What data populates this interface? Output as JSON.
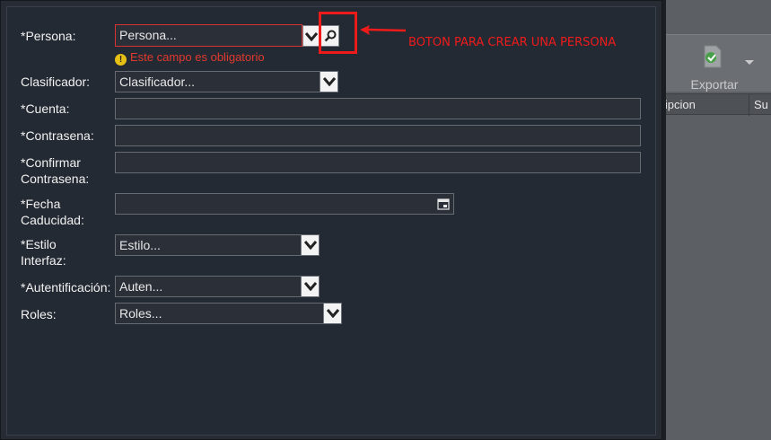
{
  "form": {
    "persona": {
      "label": "*Persona:",
      "placeholder": "Persona...",
      "error": "Este campo es obligatorio"
    },
    "clasificador": {
      "label": "Clasificador:",
      "placeholder": "Clasificador..."
    },
    "cuenta": {
      "label": "*Cuenta:",
      "value": ""
    },
    "contrasena": {
      "label": "*Contrasena:",
      "value": ""
    },
    "confirmar": {
      "label_line1": "*Confirmar",
      "label_line2": "Contrasena:",
      "value": ""
    },
    "fecha": {
      "label_line1": "*Fecha",
      "label_line2": "Caducidad:",
      "value": ""
    },
    "estilo": {
      "label_line1": "*Estilo",
      "label_line2": "Interfaz:",
      "placeholder": "Estilo..."
    },
    "autentificacion": {
      "label": "*Autentificación:",
      "placeholder": "Auten..."
    },
    "roles": {
      "label": "Roles:",
      "placeholder": "Roles..."
    }
  },
  "annotation": {
    "text": "BOTON PARA CREAR UNA PERSONA",
    "color": "#ee1b1b"
  },
  "background": {
    "toolbar": {
      "export_label": "Exportar"
    },
    "grid_headers": [
      "cripcion",
      "Su"
    ]
  },
  "colors": {
    "error": "#e0392e",
    "dialog_bg": "#242a33"
  }
}
